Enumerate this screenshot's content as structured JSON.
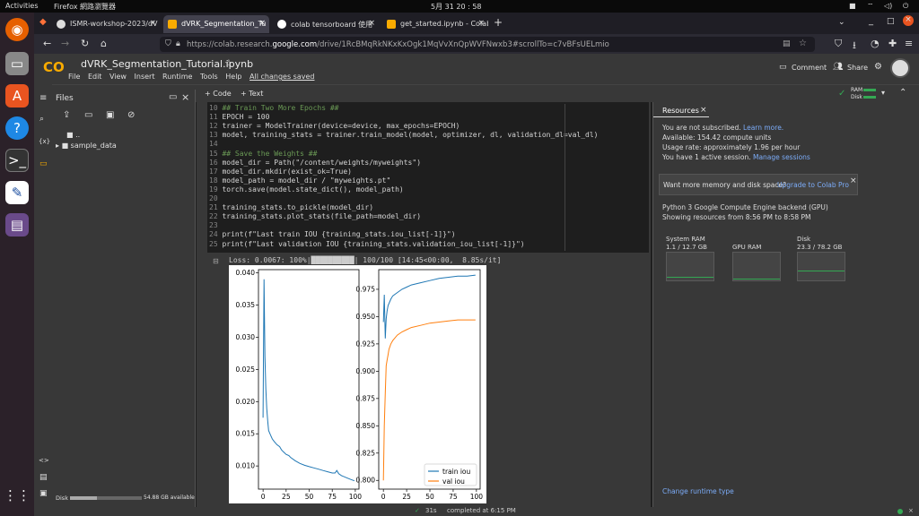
{
  "os": {
    "activities": "Activities",
    "app_name": "Firefox 網路瀏覽器",
    "clock": "5月 31 20 : 58"
  },
  "tabs": [
    {
      "title": "ISMR-workshop-2023/dV"
    },
    {
      "title": "dVRK_Segmentation_Tu"
    },
    {
      "title": "colab tensorboard 使用"
    },
    {
      "title": "get_started.ipynb - Colab"
    }
  ],
  "url": {
    "prefix": "https://colab.research.",
    "host": "google.com",
    "path": "/drive/1RcBMqRkNKxKxOgk1MqVvXnQpWVFNwxb3#scrollTo=c7vBFsUELmio"
  },
  "colab": {
    "notebook_title": "dVRK_Segmentation_Tutorial.ipynb",
    "menus": [
      "File",
      "Edit",
      "View",
      "Insert",
      "Runtime",
      "Tools",
      "Help"
    ],
    "saved": "All changes saved",
    "comment": "Comment",
    "share": "Share",
    "add_code": "+ Code",
    "add_text": "+ Text",
    "ram_label": "RAM",
    "disk_label": "Disk"
  },
  "files": {
    "title": "Files",
    "parent": "..",
    "folder": "sample_data",
    "disk_label": "Disk",
    "disk_available": "54.88 GB available",
    "disk_fraction": 0.37
  },
  "code_lines": [
    {
      "n": "10",
      "text": "## Train Two More Epochs ##",
      "cls": "cm"
    },
    {
      "n": "11",
      "text": "EPOCH = 100",
      "cls": ""
    },
    {
      "n": "12",
      "text": "trainer = ModelTrainer(device=device, max_epochs=EPOCH)",
      "cls": ""
    },
    {
      "n": "13",
      "text": "model, training_stats = trainer.train_model(model, optimizer, dl, validation_dl=val_dl)",
      "cls": ""
    },
    {
      "n": "14",
      "text": "",
      "cls": ""
    },
    {
      "n": "15",
      "text": "## Save the Weights ##",
      "cls": "cm"
    },
    {
      "n": "16",
      "text": "model_dir = Path(\"/content/weights/myweights\")",
      "cls": ""
    },
    {
      "n": "17",
      "text": "model_dir.mkdir(exist_ok=True)",
      "cls": ""
    },
    {
      "n": "18",
      "text": "model_path = model_dir / \"myweights.pt\"",
      "cls": ""
    },
    {
      "n": "19",
      "text": "torch.save(model.state_dict(), model_path)",
      "cls": ""
    },
    {
      "n": "20",
      "text": "",
      "cls": ""
    },
    {
      "n": "21",
      "text": "training_stats.to_pickle(model_dir)",
      "cls": ""
    },
    {
      "n": "22",
      "text": "training_stats.plot_stats(file_path=model_dir)",
      "cls": ""
    },
    {
      "n": "23",
      "text": "",
      "cls": ""
    },
    {
      "n": "24",
      "text": "print(f\"Last train IOU {training_stats.iou_list[-1]}\")",
      "cls": ""
    },
    {
      "n": "25",
      "text": "print(f\"Last validation IOU {training_stats.validation_iou_list[-1]}\")",
      "cls": ""
    }
  ],
  "output": {
    "progress": "Loss: 0.0067: 100%|██████████| 100/100 [14:45<00:00,  8.85s/it]"
  },
  "resources": {
    "tab": "Resources",
    "not_subscribed": "You are not subscribed.",
    "learn_more": "Learn more.",
    "available": "Available: 154.42 compute units",
    "usage": "Usage rate: approximately 1.96 per hour",
    "sessions": "You have 1 active session.",
    "manage": "Manage sessions",
    "promo": "Want more memory and disk space?",
    "upgrade": "Upgrade to Colab Pro",
    "backend": "Python 3 Google Compute Engine backend (GPU)",
    "showing": "Showing resources from 8:56 PM to 8:58 PM",
    "sysram_label": "System RAM",
    "sysram_value": "1.1 / 12.7 GB",
    "gpuram_label": "GPU RAM",
    "disk_label": "Disk",
    "disk_value": "23.3 / 78.2 GB",
    "change_runtime": "Change runtime type"
  },
  "status": {
    "duration": "31s",
    "completed": "completed at 6:15 PM"
  },
  "chart_data": [
    {
      "type": "line",
      "x": [
        0,
        1,
        2,
        3,
        4,
        5,
        6,
        8,
        10,
        12,
        15,
        18,
        20,
        22,
        25,
        28,
        30,
        35,
        40,
        45,
        50,
        55,
        60,
        65,
        70,
        75,
        78,
        80,
        82,
        85,
        90,
        95,
        99
      ],
      "series": [
        {
          "values": [
            0.0175,
            0.039,
            0.027,
            0.022,
            0.019,
            0.017,
            0.0155,
            0.0148,
            0.0142,
            0.0138,
            0.0133,
            0.013,
            0.0125,
            0.0122,
            0.0118,
            0.0116,
            0.0113,
            0.0108,
            0.0104,
            0.0101,
            0.0099,
            0.0097,
            0.0095,
            0.0093,
            0.0091,
            0.0089,
            0.0089,
            0.0093,
            0.0088,
            0.0085,
            0.0082,
            0.0079,
            0.0077
          ]
        }
      ],
      "xlim": [
        -5,
        104
      ],
      "ylim": [
        0.0064,
        0.0405
      ],
      "xticks": [
        0,
        25,
        50,
        75,
        100
      ],
      "yticks": [
        0.01,
        0.015,
        0.02,
        0.025,
        0.03,
        0.035,
        0.04
      ],
      "ytick_labels": [
        "0.010",
        "0.015",
        "0.020",
        "0.025",
        "0.030",
        "0.035",
        "0.040"
      ]
    },
    {
      "type": "line",
      "x": [
        0,
        1,
        2,
        3,
        4,
        5,
        6,
        8,
        10,
        15,
        20,
        25,
        30,
        40,
        50,
        60,
        70,
        80,
        90,
        99
      ],
      "series": [
        {
          "name": "train iou",
          "color": "#1f77b4",
          "values": [
            0.945,
            0.97,
            0.93,
            0.948,
            0.955,
            0.96,
            0.962,
            0.966,
            0.969,
            0.972,
            0.975,
            0.977,
            0.979,
            0.981,
            0.983,
            0.985,
            0.986,
            0.987,
            0.987,
            0.988
          ]
        },
        {
          "name": "val iou",
          "color": "#ff7f0e",
          "values": [
            0.8,
            0.85,
            0.88,
            0.905,
            0.91,
            0.915,
            0.92,
            0.925,
            0.928,
            0.933,
            0.936,
            0.938,
            0.94,
            0.942,
            0.944,
            0.945,
            0.946,
            0.947,
            0.947,
            0.947
          ]
        }
      ],
      "xlim": [
        -5,
        104
      ],
      "ylim": [
        0.792,
        0.993
      ],
      "xticks": [
        0,
        25,
        50,
        75,
        100
      ],
      "yticks": [
        0.8,
        0.825,
        0.85,
        0.875,
        0.9,
        0.925,
        0.95,
        0.975
      ],
      "ytick_labels": [
        "0.800",
        "0.825",
        "0.850",
        "0.875",
        "0.900",
        "0.925",
        "0.950",
        "0.975"
      ],
      "legend": "bottom-right"
    }
  ]
}
